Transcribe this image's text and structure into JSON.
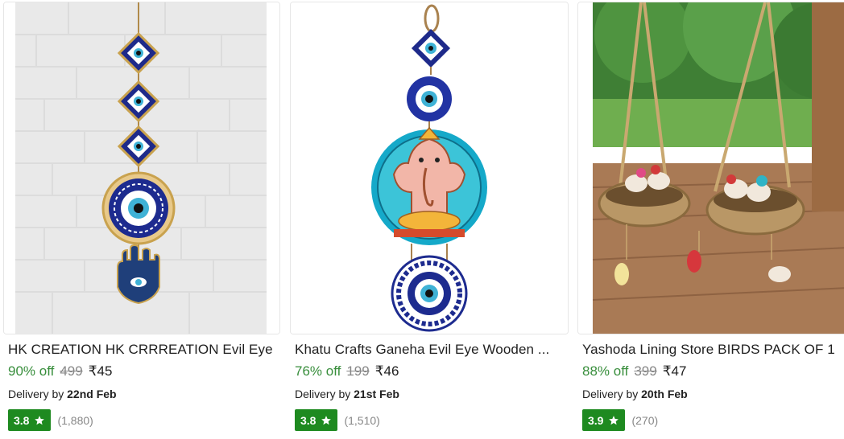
{
  "products": [
    {
      "title": "HK CREATION HK CRRREATION Evil Eye",
      "discount": "90% off",
      "mrp": "499",
      "price": "₹45",
      "delivery_prefix": "Delivery by",
      "delivery_date": "22nd Feb",
      "rating": "3.8",
      "rating_count": "(1,880)",
      "image_icon": "evil-eye-hamsa-hanging-image"
    },
    {
      "title": "Khatu Crafts Ganeha Evil Eye Wooden ...",
      "discount": "76% off",
      "mrp": "199",
      "price": "₹46",
      "delivery_prefix": "Delivery by",
      "delivery_date": "21st Feb",
      "rating": "3.8",
      "rating_count": "(1,510)",
      "image_icon": "ganesha-evil-eye-hanging-image"
    },
    {
      "title": "Yashoda Lining Store BIRDS PACK OF 1",
      "discount": "88% off",
      "mrp": "399",
      "price": "₹47",
      "delivery_prefix": "Delivery by",
      "delivery_date": "20th Feb",
      "rating": "3.9",
      "rating_count": "(270)",
      "image_icon": "birds-nest-hanging-image"
    }
  ],
  "colors": {
    "discount": "#388e3c",
    "rating_badge": "#1e8a20",
    "muted": "#878787"
  }
}
